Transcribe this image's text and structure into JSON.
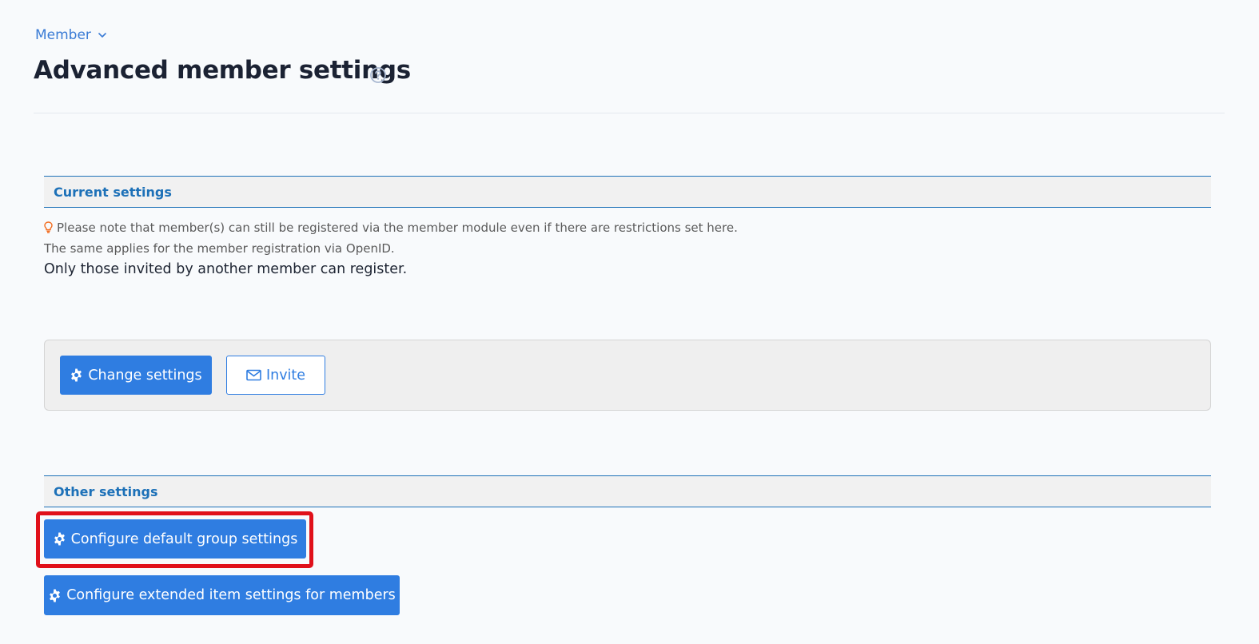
{
  "breadcrumb": {
    "label": "Member"
  },
  "page": {
    "title": "Advanced member settings"
  },
  "current_settings": {
    "header": "Current settings",
    "note_line1": "Please note that member(s) can still be registered via the member module even if there are restrictions set here.",
    "note_line2": "The same applies for the member registration via OpenID.",
    "status": "Only those invited by another member can register."
  },
  "actions": {
    "change_settings_label": "Change settings",
    "invite_label": "Invite"
  },
  "other_settings": {
    "header": "Other settings",
    "configure_group_label": "Configure default group settings",
    "configure_extended_label": "Configure extended item settings for members"
  },
  "colors": {
    "accent": "#2f7de1",
    "section_header": "#1d71b8",
    "highlight": "#e0101a",
    "bulb": "#f26b1d"
  },
  "icons": {
    "breadcrumb": "chevron-down-icon",
    "help": "help-circle-icon",
    "note": "lightbulb-icon",
    "settings": "gear-icon",
    "invite": "envelope-icon"
  }
}
